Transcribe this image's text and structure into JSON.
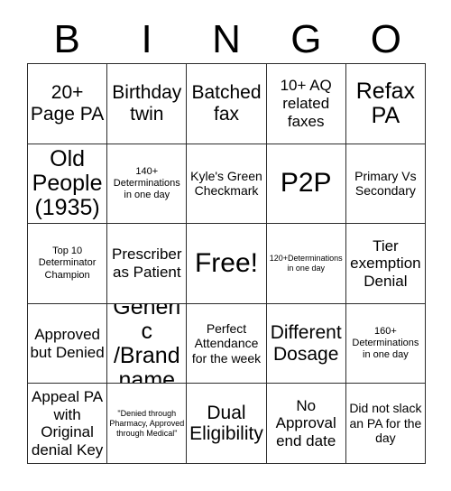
{
  "card": {
    "header_letters": [
      "B",
      "I",
      "N",
      "G",
      "O"
    ],
    "rows": [
      [
        {
          "text": "20+ Page PA",
          "size": "lg"
        },
        {
          "text": "Birthday twin",
          "size": "lg"
        },
        {
          "text": "Batched fax",
          "size": "lg"
        },
        {
          "text": "10+ AQ related faxes",
          "size": "md"
        },
        {
          "text": "Refax PA",
          "size": "xl"
        }
      ],
      [
        {
          "text": "Old People (1935)",
          "size": "xl"
        },
        {
          "text": "140+ Determinations in one day",
          "size": "xs"
        },
        {
          "text": "Kyle's Green Checkmark",
          "size": "sm"
        },
        {
          "text": "P2P",
          "size": "xxl"
        },
        {
          "text": "Primary Vs Secondary",
          "size": "sm"
        }
      ],
      [
        {
          "text": "Top 10 Determinator Champion",
          "size": "xs"
        },
        {
          "text": "Prescriber as Patient",
          "size": "md"
        },
        {
          "text": "Free!",
          "size": "xxl"
        },
        {
          "text": "120+Determinations in one day",
          "size": "xxs"
        },
        {
          "text": "Tier exemption Denial",
          "size": "md"
        }
      ],
      [
        {
          "text": "Approved but Denied",
          "size": "md"
        },
        {
          "text": "Generic /Brand name",
          "size": "xl"
        },
        {
          "text": "Perfect Attendance for the week",
          "size": "sm"
        },
        {
          "text": "Different Dosage",
          "size": "lg"
        },
        {
          "text": "160+ Determinations in one day",
          "size": "xs"
        }
      ],
      [
        {
          "text": "Appeal PA with Original denial Key",
          "size": "md"
        },
        {
          "text": "\"Denied through Pharmacy, Approved through Medical\"",
          "size": "xxs"
        },
        {
          "text": "Dual Eligibility",
          "size": "lg"
        },
        {
          "text": "No Approval end date",
          "size": "md"
        },
        {
          "text": "Did not slack an PA for the day",
          "size": "sm"
        }
      ]
    ],
    "colors": {
      "background": "#ffffff",
      "text": "#000000",
      "grid_line": "#2b2b2b"
    }
  }
}
